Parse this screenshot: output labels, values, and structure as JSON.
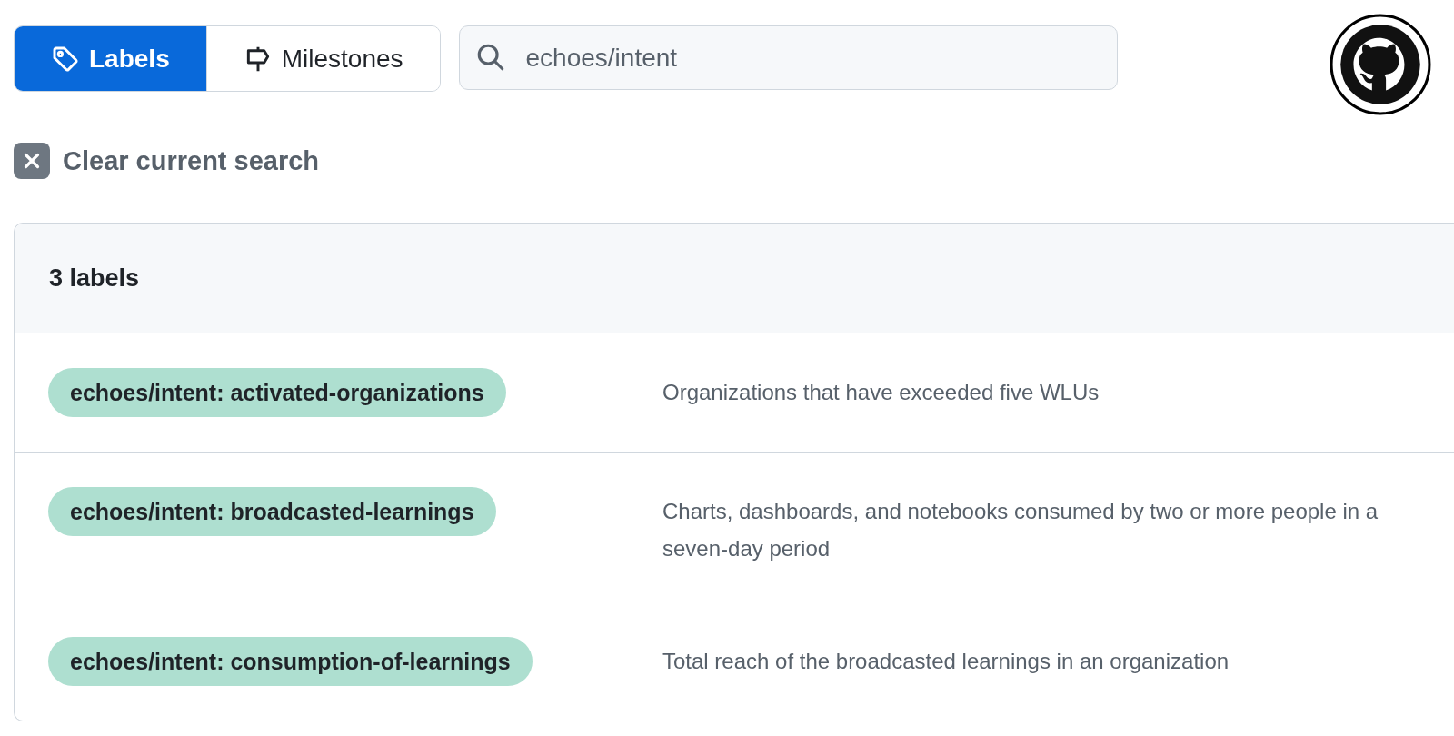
{
  "tabs": [
    {
      "label": "Labels",
      "selected": true
    },
    {
      "label": "Milestones",
      "selected": false
    }
  ],
  "search": {
    "value": "echoes/intent"
  },
  "clear_search": {
    "label": "Clear current search"
  },
  "labels_box": {
    "header": "3 labels",
    "rows": [
      {
        "name": "echoes/intent: activated-organizations",
        "color": "#aedfd0",
        "description": "Organizations that have exceeded five WLUs"
      },
      {
        "name": "echoes/intent: broadcasted-learnings",
        "color": "#aedfd0",
        "description": "Charts, dashboards, and notebooks consumed by two or more people in a seven-day period"
      },
      {
        "name": "echoes/intent: consumption-of-learnings",
        "color": "#aedfd0",
        "description": "Total reach of the broadcasted learnings in an organization"
      }
    ]
  }
}
